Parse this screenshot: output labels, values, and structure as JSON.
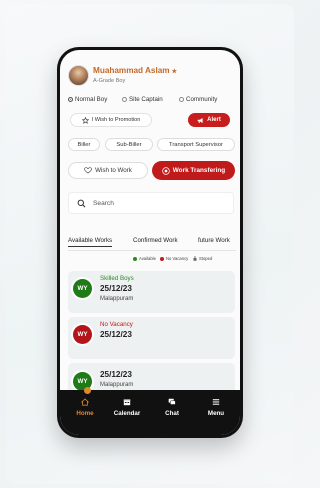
{
  "profile": {
    "name": "Muahammad Aslam",
    "grade": "A-Grade Boy"
  },
  "roles": [
    {
      "label": "Normal Boy",
      "selected": true
    },
    {
      "label": "Site Captain",
      "selected": false
    },
    {
      "label": "Community",
      "selected": false
    }
  ],
  "actions": {
    "promotion_label": "I Wish to Promotion",
    "alert_label": "Alert"
  },
  "chips": [
    "Biller",
    "Sub-Biller",
    "Transport Supervisor"
  ],
  "work": {
    "wish_label": "Wish to Work",
    "transfer_label": "Work Transfering"
  },
  "search": {
    "placeholder": "Search"
  },
  "tabs": [
    "Available Works",
    "Confirmed Work",
    "future Work"
  ],
  "legend": [
    {
      "label": "Available",
      "color": "#2a8a1e"
    },
    {
      "label": "No Vacancy",
      "color": "#c01a1a"
    },
    {
      "label": "Stoped",
      "color": "#666666"
    }
  ],
  "jobs": [
    {
      "badge": "WY",
      "title": "Skilled Boys",
      "title_color": "#2a8a1e",
      "badge_color": "#1f7a18",
      "date": "25/12/23",
      "location": "Malappuram"
    },
    {
      "badge": "WY",
      "title": "No Vacancy",
      "title_color": "#c01a1a",
      "badge_color": "#b3161a",
      "date": "25/12/23",
      "location": ""
    },
    {
      "badge": "WY",
      "title": "",
      "title_color": "#2a8a1e",
      "badge_color": "#1f7a18",
      "date": "25/12/23",
      "location": "Malappuram"
    }
  ],
  "nav": [
    {
      "label": "Home",
      "icon": "home-icon",
      "active": true
    },
    {
      "label": "Calendar",
      "icon": "calendar-icon",
      "active": false
    },
    {
      "label": "Chat",
      "icon": "chat-icon",
      "active": false
    },
    {
      "label": "Menu",
      "icon": "menu-icon",
      "active": false
    }
  ],
  "colors": {
    "accent": "#c81d1d",
    "brand_orange": "#c4692a",
    "nav_bg": "#111111"
  }
}
